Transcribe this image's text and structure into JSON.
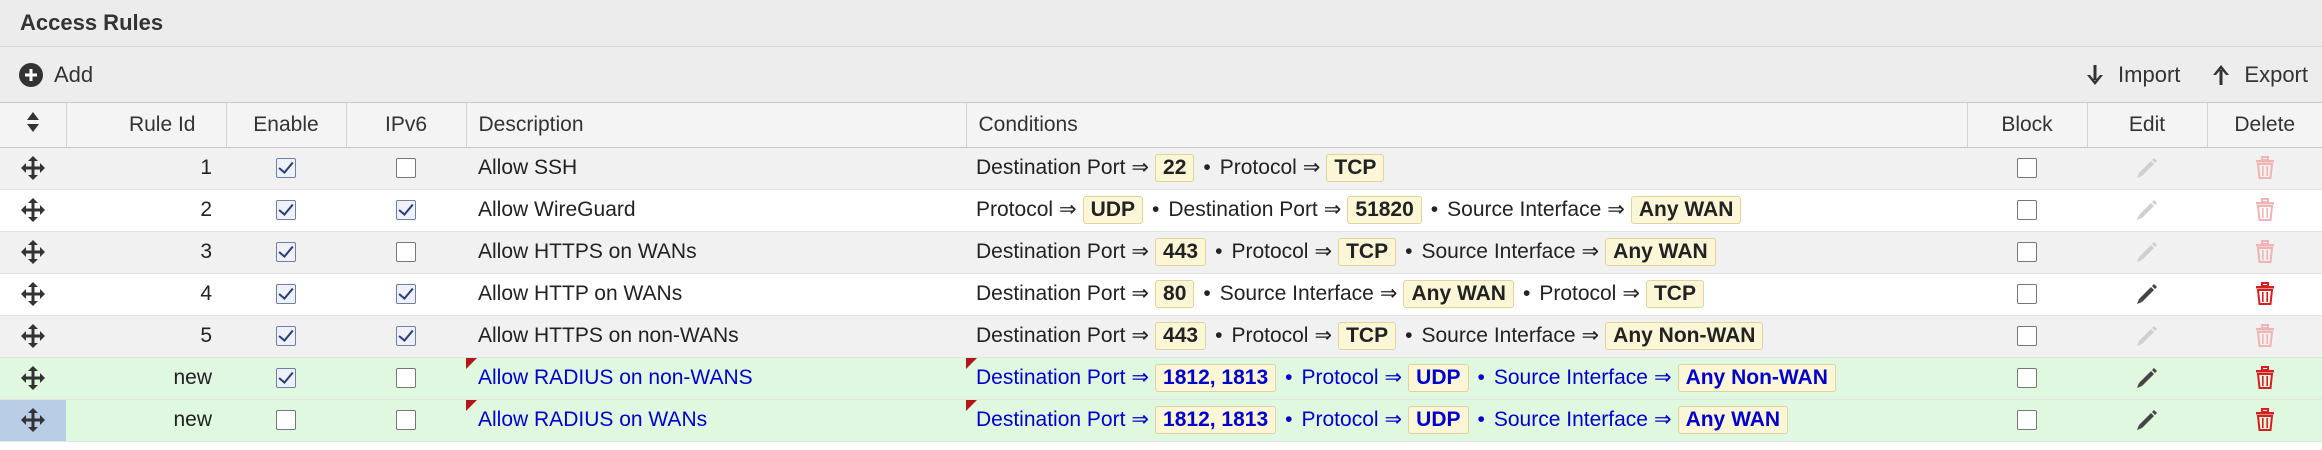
{
  "panel": {
    "title": "Access Rules"
  },
  "toolbar": {
    "add_label": "Add",
    "import_label": "Import",
    "export_label": "Export"
  },
  "columns": {
    "rule_id": "Rule Id",
    "enable": "Enable",
    "ipv6": "IPv6",
    "description": "Description",
    "conditions": "Conditions",
    "block": "Block",
    "edit": "Edit",
    "delete": "Delete"
  },
  "colors": {
    "new_row": "#e0f7e0",
    "new_text": "#0000cc",
    "delete_red": "#d62020",
    "chip_bg": "#fbf6d6"
  },
  "icons": {
    "add": "plus-circle-icon",
    "import": "arrow-down-icon",
    "export": "arrow-up-icon",
    "sort": "sort-icon",
    "drag": "move-icon",
    "edit": "pencil-icon",
    "delete": "trash-icon"
  },
  "rows": [
    {
      "id": "1",
      "enable": true,
      "ipv6": false,
      "description": "Allow SSH",
      "block": false,
      "editable": false,
      "conditions": [
        {
          "label": "Destination Port",
          "value": "22"
        },
        {
          "label": "Protocol",
          "value": "TCP"
        }
      ]
    },
    {
      "id": "2",
      "enable": true,
      "ipv6": true,
      "description": "Allow WireGuard",
      "block": false,
      "editable": false,
      "conditions": [
        {
          "label": "Protocol",
          "value": "UDP"
        },
        {
          "label": "Destination Port",
          "value": "51820"
        },
        {
          "label": "Source Interface",
          "value": "Any WAN"
        }
      ]
    },
    {
      "id": "3",
      "enable": true,
      "ipv6": false,
      "description": "Allow HTTPS on WANs",
      "block": false,
      "editable": false,
      "conditions": [
        {
          "label": "Destination Port",
          "value": "443"
        },
        {
          "label": "Protocol",
          "value": "TCP"
        },
        {
          "label": "Source Interface",
          "value": "Any WAN"
        }
      ]
    },
    {
      "id": "4",
      "enable": true,
      "ipv6": true,
      "description": "Allow HTTP on WANs",
      "block": false,
      "editable": true,
      "conditions": [
        {
          "label": "Destination Port",
          "value": "80"
        },
        {
          "label": "Source Interface",
          "value": "Any WAN"
        },
        {
          "label": "Protocol",
          "value": "TCP"
        }
      ]
    },
    {
      "id": "5",
      "enable": true,
      "ipv6": true,
      "description": "Allow HTTPS on non-WANs",
      "block": false,
      "editable": false,
      "conditions": [
        {
          "label": "Destination Port",
          "value": "443"
        },
        {
          "label": "Protocol",
          "value": "TCP"
        },
        {
          "label": "Source Interface",
          "value": "Any Non-WAN"
        }
      ]
    },
    {
      "id": "new",
      "isNew": true,
      "enable": true,
      "ipv6": false,
      "description": "Allow RADIUS on non-WANS",
      "block": false,
      "editable": true,
      "conditions": [
        {
          "label": "Destination Port",
          "value": "1812, 1813"
        },
        {
          "label": "Protocol",
          "value": "UDP"
        },
        {
          "label": "Source Interface",
          "value": "Any Non-WAN"
        }
      ]
    },
    {
      "id": "new",
      "isNew": true,
      "selected": true,
      "enable": false,
      "ipv6": false,
      "description": "Allow RADIUS on WANs",
      "block": false,
      "editable": true,
      "conditions": [
        {
          "label": "Destination Port",
          "value": "1812, 1813"
        },
        {
          "label": "Protocol",
          "value": "UDP"
        },
        {
          "label": "Source Interface",
          "value": "Any WAN"
        }
      ]
    }
  ]
}
